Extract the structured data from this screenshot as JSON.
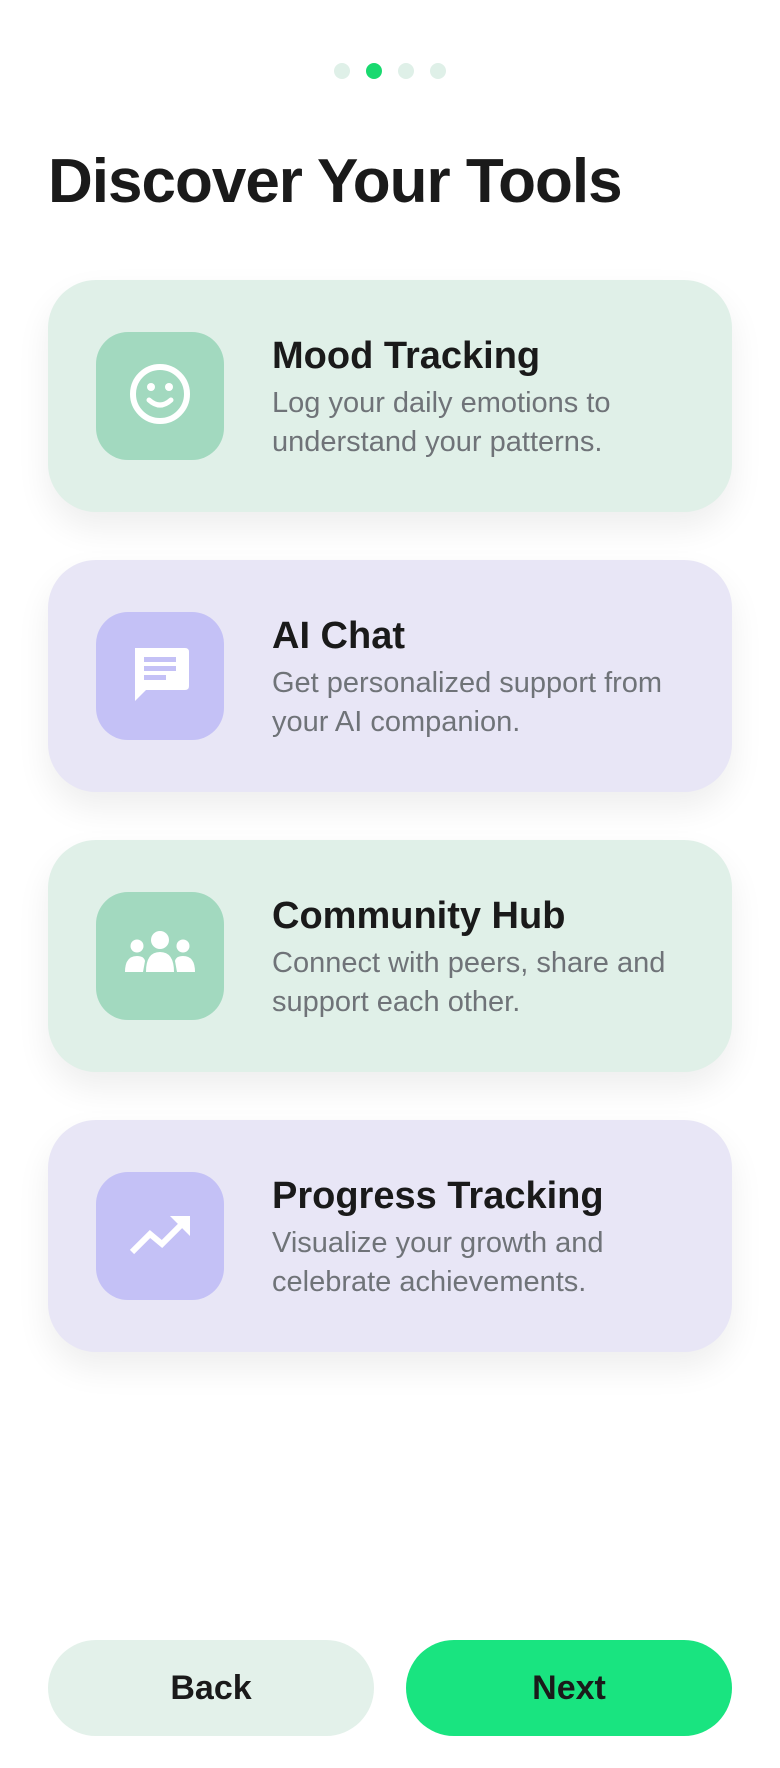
{
  "progress": {
    "total_steps": 4,
    "current_step": 2,
    "colors": {
      "active": "#19d96f",
      "inactive": "#dff0e8"
    }
  },
  "page_title": "Discover Your Tools",
  "features": [
    {
      "title": "Mood Tracking",
      "description": "Log your daily emotions to understand your patterns.",
      "icon": "smiley-face-icon",
      "theme": "green"
    },
    {
      "title": "AI Chat",
      "description": "Get personalized support from your AI companion.",
      "icon": "chat-bubble-icon",
      "theme": "purple"
    },
    {
      "title": "Community Hub",
      "description": "Connect with peers, share and support each other.",
      "icon": "group-people-icon",
      "theme": "green"
    },
    {
      "title": "Progress Tracking",
      "description": "Visualize your growth and celebrate achievements.",
      "icon": "trending-up-icon",
      "theme": "purple"
    }
  ],
  "buttons": {
    "back_label": "Back",
    "next_label": "Next"
  },
  "colors": {
    "accent": "#19e480",
    "green_card": "#e0f0e8",
    "green_icon_bg": "#a2d9bf",
    "purple_card": "#e8e6f6",
    "purple_icon_bg": "#c4c1f6"
  }
}
